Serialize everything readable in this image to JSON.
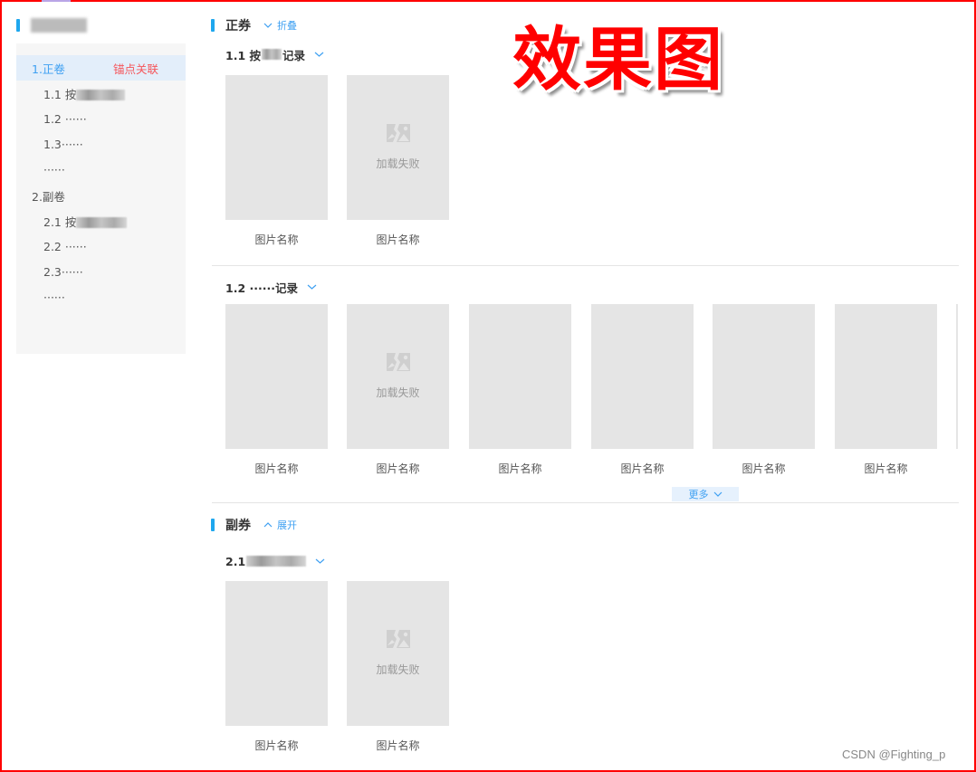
{
  "overlay": {
    "effect_title": "效果图",
    "watermark": "CSDN @Fighting_p"
  },
  "sidebar": {
    "title": "[blurred]",
    "items": [
      {
        "label": "1.正卷",
        "level": 1,
        "active": true,
        "tag": "锚点关联"
      },
      {
        "label": "1.1 按",
        "level": 2,
        "blurred_suffix": true
      },
      {
        "label": "1.2 ······",
        "level": 2
      },
      {
        "label": "1.3······",
        "level": 2
      },
      {
        "label": "······",
        "level": 2
      },
      {
        "label": "2.副卷",
        "level": 1
      },
      {
        "label": "2.1 按",
        "level": 2,
        "blurred_suffix": true
      },
      {
        "label": "2.2 ······",
        "level": 2
      },
      {
        "label": "2.3······",
        "level": 2
      },
      {
        "label": "······",
        "level": 2
      }
    ]
  },
  "colors": {
    "accent": "#1ea7ee",
    "link": "#3ea0f2",
    "anchor_tag": "#f5565b",
    "active_bg": "#e3eefa",
    "placeholder": "#e5e5e5",
    "frame": "#ff0000"
  },
  "main": {
    "sections": [
      {
        "title": "正券",
        "toggle_label": "折叠",
        "toggle_icon": "chevron-down-icon",
        "groups": [
          {
            "title": "1.1 按",
            "blurred_suffix": true,
            "title_end": "记录",
            "cards": [
              {
                "name": "图片名称",
                "failed": false
              },
              {
                "name": "图片名称",
                "failed": true,
                "fail_text": "加载失败"
              }
            ]
          },
          {
            "title": "1.2 ······记录",
            "cards": [
              {
                "name": "图片名称",
                "failed": false
              },
              {
                "name": "图片名称",
                "failed": true,
                "fail_text": "加载失败"
              },
              {
                "name": "图片名称",
                "failed": false
              },
              {
                "name": "图片名称",
                "failed": false
              },
              {
                "name": "图片名称",
                "failed": false
              },
              {
                "name": "图片名称",
                "failed": false
              }
            ],
            "more_label": "更多"
          }
        ]
      },
      {
        "title": "副券",
        "toggle_label": "展开",
        "toggle_icon": "chevron-up-icon",
        "groups": [
          {
            "title": "2.1",
            "blurred_suffix": true,
            "cards": [
              {
                "name": "图片名称",
                "failed": false
              },
              {
                "name": "图片名称",
                "failed": true,
                "fail_text": "加载失败"
              }
            ]
          }
        ]
      }
    ]
  }
}
